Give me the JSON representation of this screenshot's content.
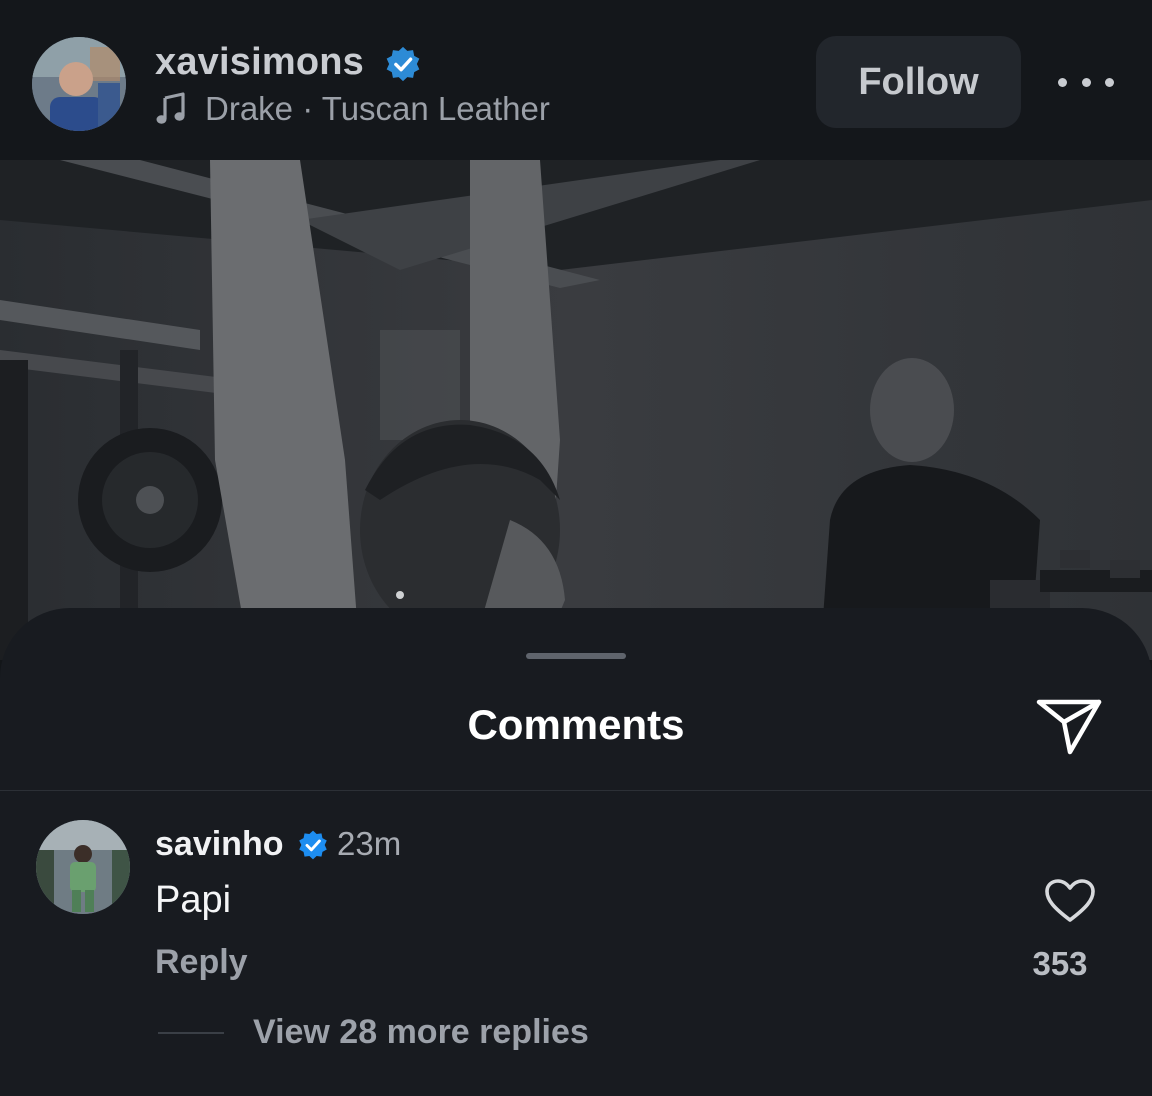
{
  "post_header": {
    "username": "xavisimons",
    "music": "Drake · Tuscan Leather",
    "follow_label": "Follow"
  },
  "icons": {
    "verified": "verified-badge-icon",
    "music": "music-note-icon",
    "more": "more-options-icon",
    "share": "share-icon",
    "like": "heart-icon"
  },
  "colors": {
    "verified_blue": "#0095f6",
    "background": "#181b20"
  },
  "comments_sheet": {
    "title": "Comments"
  },
  "comment": {
    "username": "savinho",
    "time": "23m",
    "text": "Papi",
    "reply_label": "Reply",
    "like_count": "353",
    "view_replies_label": "View 28 more replies"
  }
}
